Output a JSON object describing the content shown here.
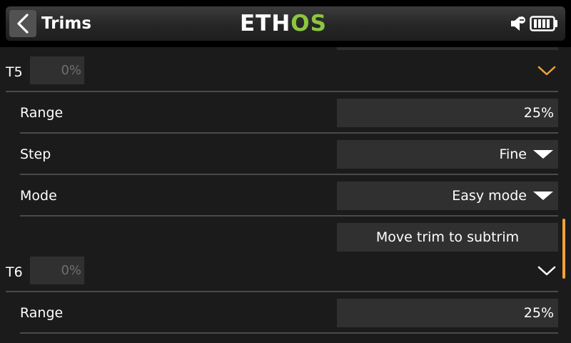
{
  "header": {
    "title": "Trims",
    "logo_main": "ETH",
    "logo_accent": "OS"
  },
  "colors": {
    "accent_orange": "#f0a33a",
    "logo_green": "#8cc63f",
    "field_bg": "#303030"
  },
  "icons": [
    "chevron-left-icon",
    "speaker-icon",
    "battery-icon",
    "chevron-down-icon",
    "triangle-down-icon"
  ],
  "groups": [
    {
      "name": "T5",
      "value": "0%",
      "expanded": true,
      "rows": {
        "range_label": "Range",
        "range_value": "25%",
        "step_label": "Step",
        "step_value": "Fine",
        "mode_label": "Mode",
        "mode_value": "Easy mode",
        "move_button": "Move trim to subtrim"
      }
    },
    {
      "name": "T6",
      "value": "0%",
      "expanded": false,
      "rows": {
        "range_label": "Range",
        "range_value": "25%"
      }
    }
  ]
}
